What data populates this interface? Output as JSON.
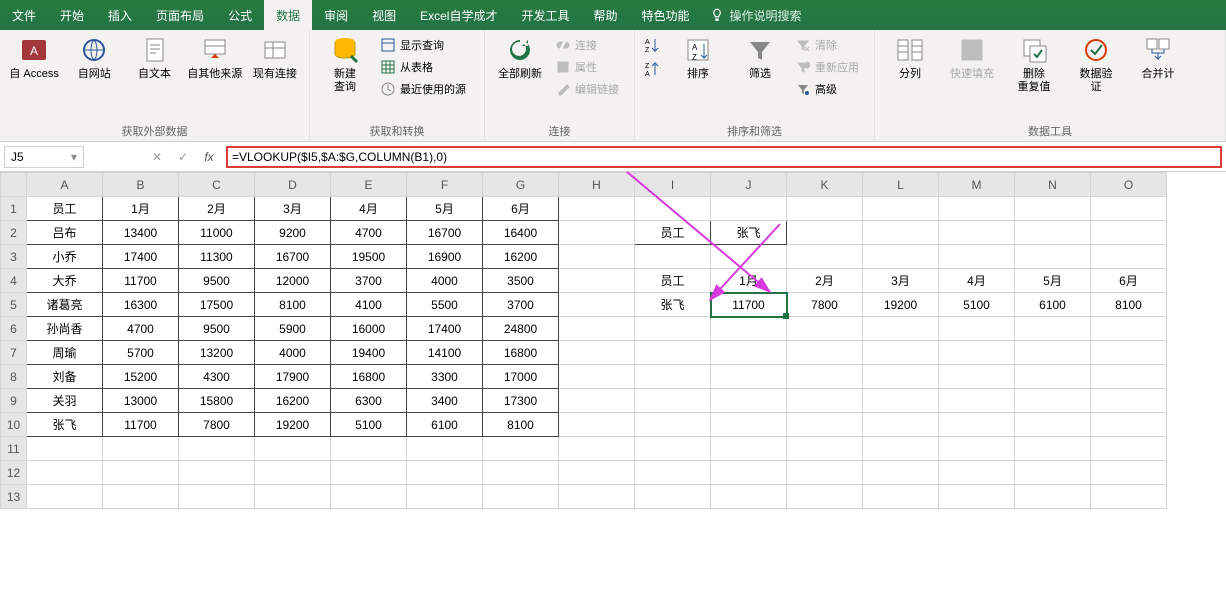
{
  "tabs": [
    "文件",
    "开始",
    "插入",
    "页面布局",
    "公式",
    "数据",
    "审阅",
    "视图",
    "Excel自学成才",
    "开发工具",
    "帮助",
    "特色功能"
  ],
  "tellMe": "操作说明搜索",
  "groups": {
    "ext": {
      "label": "获取外部数据",
      "items": [
        "自 Access",
        "自网站",
        "自文本",
        "自其他来源",
        "现有连接"
      ]
    },
    "get": {
      "label": "获取和转换",
      "new": "新建\n查询",
      "show": "显示查询",
      "table": "从表格",
      "recent": "最近使用的源"
    },
    "conn": {
      "label": "连接",
      "refresh": "全部刷新",
      "c": "连接",
      "p": "属性",
      "e": "编辑链接"
    },
    "sort": {
      "label": "排序和筛选",
      "sort": "排序",
      "filter": "筛选",
      "clear": "清除",
      "reapply": "重新应用",
      "adv": "高级"
    },
    "tools": {
      "label": "数据工具",
      "split": "分列",
      "fill": "快速填充",
      "dup": "删除\n重复值",
      "val": "数据验\n证",
      "cons": "合并计"
    }
  },
  "nameBox": "J5",
  "formula": "=VLOOKUP($I5,$A:$G,COLUMN(B1),0)",
  "cols": [
    "A",
    "B",
    "C",
    "D",
    "E",
    "F",
    "G",
    "H",
    "I",
    "J",
    "K",
    "L",
    "M",
    "N",
    "O"
  ],
  "rows": [
    1,
    2,
    3,
    4,
    5,
    6,
    7,
    8,
    9,
    10,
    11,
    12,
    13
  ],
  "table": {
    "header": [
      "员工",
      "1月",
      "2月",
      "3月",
      "4月",
      "5月",
      "6月"
    ],
    "data": [
      [
        "吕布",
        13400,
        11000,
        9200,
        4700,
        16700,
        16400
      ],
      [
        "小乔",
        17400,
        11300,
        16700,
        19500,
        16900,
        16200
      ],
      [
        "大乔",
        11700,
        9500,
        12000,
        3700,
        4000,
        3500
      ],
      [
        "诸葛亮",
        16300,
        17500,
        8100,
        4100,
        5500,
        3700
      ],
      [
        "孙尚香",
        4700,
        9500,
        5900,
        16000,
        17400,
        24800
      ],
      [
        "周瑜",
        5700,
        13200,
        4000,
        19400,
        14100,
        16800
      ],
      [
        "刘备",
        15200,
        4300,
        17900,
        16800,
        3300,
        17000
      ],
      [
        "关羽",
        13000,
        15800,
        16200,
        6300,
        3400,
        17300
      ],
      [
        "张飞",
        11700,
        7800,
        19200,
        5100,
        6100,
        8100
      ]
    ]
  },
  "lookup": {
    "label": "员工",
    "value": "张飞",
    "header": [
      "员工",
      "1月",
      "2月",
      "3月",
      "4月",
      "5月",
      "6月"
    ],
    "row": [
      "张飞",
      11700,
      7800,
      19200,
      5100,
      6100,
      8100
    ]
  },
  "chart_data": {
    "type": "table",
    "title": "员工月度数据",
    "columns": [
      "员工",
      "1月",
      "2月",
      "3月",
      "4月",
      "5月",
      "6月"
    ],
    "rows": [
      [
        "吕布",
        13400,
        11000,
        9200,
        4700,
        16700,
        16400
      ],
      [
        "小乔",
        17400,
        11300,
        16700,
        19500,
        16900,
        16200
      ],
      [
        "大乔",
        11700,
        9500,
        12000,
        3700,
        4000,
        3500
      ],
      [
        "诸葛亮",
        16300,
        17500,
        8100,
        4100,
        5500,
        3700
      ],
      [
        "孙尚香",
        4700,
        9500,
        5900,
        16000,
        17400,
        24800
      ],
      [
        "周瑜",
        5700,
        13200,
        4000,
        19400,
        14100,
        16800
      ],
      [
        "刘备",
        15200,
        4300,
        17900,
        16800,
        3300,
        17000
      ],
      [
        "关羽",
        13000,
        15800,
        16200,
        6300,
        3400,
        17300
      ],
      [
        "张飞",
        11700,
        7800,
        19200,
        5100,
        6100,
        8100
      ]
    ]
  }
}
